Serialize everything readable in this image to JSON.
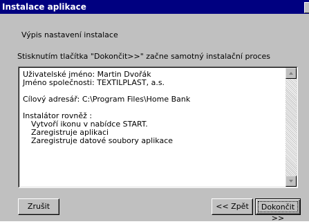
{
  "window": {
    "title": "Instalace aplikace"
  },
  "page": {
    "heading": "Výpis nastavení instalace",
    "instruction": "Stisknutím tlačítka \"Dokončit>>\" začne samotný instalační proces"
  },
  "summary": {
    "line1": "Uživatelské jméno: Martin Dvořák",
    "line2": "Jméno společnosti: TEXTILPLAST, a.s.",
    "line3": "Cílový adresář: C:\\Program Files\\Home Bank",
    "line4": "Instalátor rovněž :",
    "line5": "Vytvoří ikonu v nabídce START.",
    "line6": "Zaregistruje aplikaci",
    "line7": "Zaregistruje datové soubory aplikace"
  },
  "buttons": {
    "cancel": "Zrušit",
    "back": "<< Zpět",
    "finish": "Dokončit >>"
  }
}
